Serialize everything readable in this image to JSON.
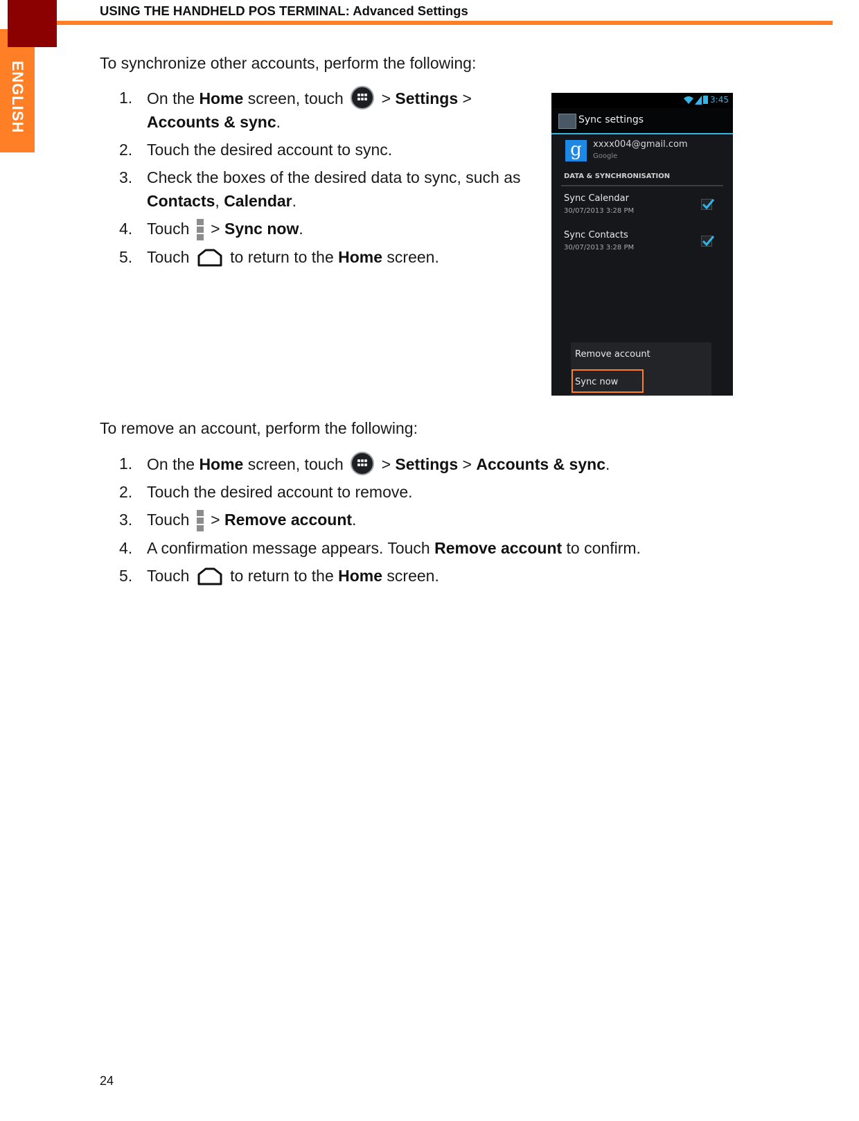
{
  "header": {
    "title": "USING THE HANDHELD POS TERMINAL: Advanced Settings",
    "language_tab": "ENGLISH"
  },
  "sync_section": {
    "intro": "To synchronize other accounts, perform the following:",
    "steps": [
      {
        "num": "1.",
        "parts": [
          {
            "t": "On the "
          },
          {
            "t": "Home",
            "b": true
          },
          {
            "t": " screen, touch "
          },
          {
            "icon": "apps-icon"
          },
          {
            "t": " > "
          },
          {
            "t": "Settings",
            "b": true
          },
          {
            "t": " >"
          },
          {
            "br": true
          },
          {
            "t": "Accounts & sync",
            "b": true
          },
          {
            "t": "."
          }
        ]
      },
      {
        "num": "2.",
        "parts": [
          {
            "t": "Touch the desired account to sync."
          }
        ]
      },
      {
        "num": "3.",
        "parts": [
          {
            "t": "Check the boxes of the desired data to sync, such as"
          },
          {
            "br": true
          },
          {
            "t": "Contacts",
            "b": true
          },
          {
            "t": ", "
          },
          {
            "t": "Calendar",
            "b": true
          },
          {
            "t": "."
          }
        ]
      },
      {
        "num": "4.",
        "parts": [
          {
            "t": "Touch "
          },
          {
            "icon": "menu-icon"
          },
          {
            "t": " > "
          },
          {
            "t": "Sync now",
            "b": true
          },
          {
            "t": "."
          }
        ]
      },
      {
        "num": "5.",
        "parts": [
          {
            "t": "Touch "
          },
          {
            "icon": "home-icon"
          },
          {
            "t": " to return to the "
          },
          {
            "t": "Home",
            "b": true
          },
          {
            "t": " screen."
          }
        ]
      }
    ]
  },
  "remove_section": {
    "intro": "To remove an account, perform the following:",
    "steps": [
      {
        "num": "1.",
        "parts": [
          {
            "t": "On the "
          },
          {
            "t": "Home",
            "b": true
          },
          {
            "t": " screen, touch "
          },
          {
            "icon": "apps-icon"
          },
          {
            "t": " > "
          },
          {
            "t": "Settings",
            "b": true
          },
          {
            "t": " > "
          },
          {
            "t": "Accounts & sync",
            "b": true
          },
          {
            "t": "."
          }
        ]
      },
      {
        "num": "2.",
        "parts": [
          {
            "t": "Touch the desired account to remove."
          }
        ]
      },
      {
        "num": "3.",
        "parts": [
          {
            "t": "Touch "
          },
          {
            "icon": "menu-icon"
          },
          {
            "t": " > "
          },
          {
            "t": "Remove account",
            "b": true
          },
          {
            "t": "."
          }
        ]
      },
      {
        "num": "4.",
        "parts": [
          {
            "t": "A confirmation message appears. Touch "
          },
          {
            "t": "Remove account",
            "b": true
          },
          {
            "t": " to confirm."
          }
        ]
      },
      {
        "num": "5.",
        "parts": [
          {
            "t": "Touch "
          },
          {
            "icon": "home-icon"
          },
          {
            "t": " to return to the "
          },
          {
            "t": "Home",
            "b": true
          },
          {
            "t": " screen."
          }
        ]
      }
    ]
  },
  "phone_screenshot": {
    "status_time": "3:45",
    "title": "Sync settings",
    "account_email": "xxxx004@gmail.com",
    "account_provider": "Google",
    "google_glyph": "g",
    "section_header": "DATA & SYNCHRONISATION",
    "items": [
      {
        "title": "Sync Calendar",
        "subtitle": "30/07/2013 3:28 PM",
        "checked": true
      },
      {
        "title": "Sync Contacts",
        "subtitle": "30/07/2013 3:28 PM",
        "checked": true
      }
    ],
    "menu": [
      "Remove account",
      "Sync now"
    ],
    "highlighted_menu_item": "Sync now",
    "colors": {
      "accent": "#33b5e5",
      "highlight": "#ff7f27"
    }
  },
  "footer": {
    "page_number": "24"
  },
  "colors": {
    "brand_orange": "#ff7f27",
    "brand_dark_red": "#8b0000"
  }
}
